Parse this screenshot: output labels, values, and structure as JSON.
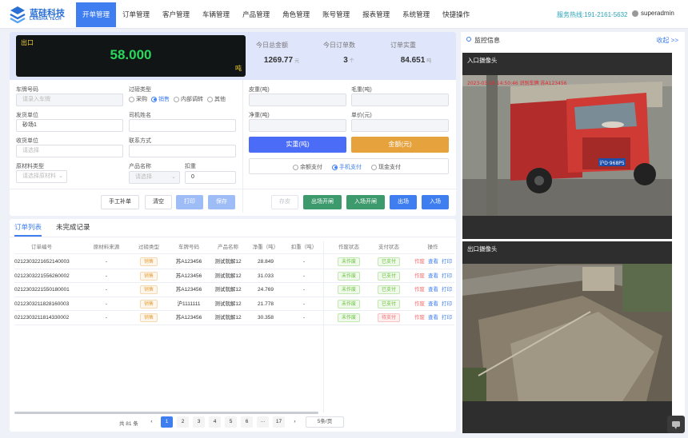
{
  "brand": {
    "name": "蓝硅科技",
    "sub": "LANSHA TECH"
  },
  "nav": [
    "开单管理",
    "订单管理",
    "客户管理",
    "车辆管理",
    "产品管理",
    "角色管理",
    "账号管理",
    "报表管理",
    "系统管理",
    "快捷操作"
  ],
  "hotline": "服务热线:191-2161-5632",
  "user": "superadmin",
  "display": {
    "label": "出口",
    "value": "58.000",
    "unit": "吨"
  },
  "stats": [
    {
      "label": "今日总金额",
      "value": "1269.77",
      "unit": "元"
    },
    {
      "label": "今日订单数",
      "value": "3",
      "unit": "个"
    },
    {
      "label": "订单实重",
      "value": "84.651",
      "unit": "吨"
    }
  ],
  "form": {
    "plate_label": "车牌号码",
    "plate_placeholder": "请录入车牌",
    "filter_label": "过磅类型",
    "filter_options": [
      "采购",
      "销售",
      "内部调转",
      "其他"
    ],
    "sender_label": "发货单位",
    "sender_value": "砂场1",
    "driver_label": "司机姓名",
    "receiver_label": "收货单位",
    "receiver_placeholder": "请选择",
    "contact_label": "联系方式",
    "material_label": "原材料类型",
    "material_placeholder": "请选择原材料",
    "product_label": "产品名称",
    "product_placeholder": "请选择",
    "deduct_label": "扣重",
    "deduct_value": "0",
    "tare_label": "皮重(吨)",
    "gross_label": "毛重(吨)",
    "net_label": "净重(吨)",
    "price_label": "单价(元)",
    "real_weight_btn": "实重(吨)",
    "amount_btn": "金额(元)",
    "pay_options": [
      "余额支付",
      "手机支付",
      "现金支付"
    ]
  },
  "buttons": {
    "manual": "手工补单",
    "clear": "清空",
    "print": "打印",
    "save": "保存",
    "keep": "存皮",
    "exit_open": "出场开闸",
    "enter_open": "入场开闸",
    "exit": "出场",
    "enter": "入场"
  },
  "tabs": [
    "订单列表",
    "未完成记录"
  ],
  "columns": [
    "订单编号",
    "原材料来源",
    "过磅类型",
    "车牌号码",
    "产品名称",
    "净重（吨）",
    "扣重（吨）",
    "作废状态",
    "支付状态",
    "操作"
  ],
  "rows": [
    {
      "id": "0212303221652140003",
      "src": "-",
      "type": "销售",
      "plate": "苏A123456",
      "product": "测试就解12",
      "net": "28.849",
      "deduct": "-",
      "void": "未作废",
      "pay": "已支付",
      "pay_status": "paid"
    },
    {
      "id": "0212303221556260002",
      "src": "-",
      "type": "销售",
      "plate": "苏A123456",
      "product": "测试就解12",
      "net": "31.033",
      "deduct": "-",
      "void": "未作废",
      "pay": "已支付",
      "pay_status": "paid"
    },
    {
      "id": "0212303221550180001",
      "src": "-",
      "type": "销售",
      "plate": "苏A123456",
      "product": "测试就解12",
      "net": "24.769",
      "deduct": "-",
      "void": "未作废",
      "pay": "已支付",
      "pay_status": "paid"
    },
    {
      "id": "0212303211828160003",
      "src": "-",
      "type": "销售",
      "plate": "沪1111111",
      "product": "测试就解12",
      "net": "21.778",
      "deduct": "-",
      "void": "未作废",
      "pay": "已支付",
      "pay_status": "paid"
    },
    {
      "id": "0212303211814330002",
      "src": "-",
      "type": "销售",
      "plate": "苏A123456",
      "product": "测试就解12",
      "net": "30.358",
      "deduct": "-",
      "void": "未作废",
      "pay": "待支付",
      "pay_status": "pending"
    }
  ],
  "row_actions": [
    "作废",
    "查看",
    "打印"
  ],
  "pager": {
    "total": "共 81 条",
    "pages": [
      "1",
      "2",
      "3",
      "4",
      "5",
      "6",
      "···",
      "17"
    ],
    "size": "5条/页"
  },
  "monitor": {
    "title": "监控信息",
    "collapse": "收起 >>",
    "cam_in": "入口摄像头",
    "cam_out": "出口摄像头",
    "overlay": "2023-03-18 14:50:46 识别车牌 苏A123456",
    "plate_text": "沪D·968P5"
  },
  "colors": {
    "primary": "#3e7ef1",
    "green": "#3d9a6c",
    "orange": "#e6a23c",
    "display_bg": "#121515",
    "display_value": "#28d85c"
  }
}
